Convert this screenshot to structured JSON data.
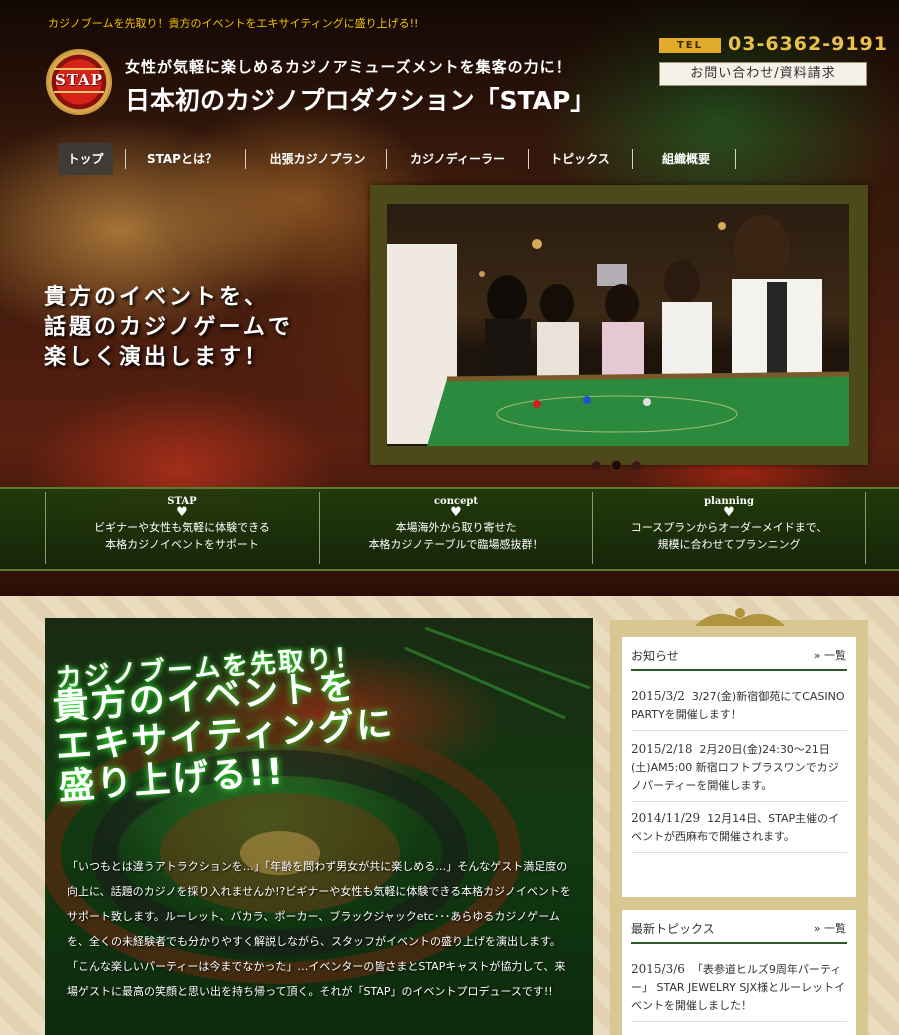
{
  "header": {
    "tagline": "カジノブームを先取り！貴方のイベントをエキサイティングに盛り上げる!!",
    "logo_text": "STAP",
    "subtitle": "女性が気軽に楽しめるカジノアミューズメントを集客の力に！",
    "title": "日本初のカジノプロダクション「STAP」",
    "tel_label": "TEL",
    "tel_number": "03-6362-9191",
    "contact_button": "お問い合わせ/資料請求"
  },
  "nav": {
    "items": [
      "トップ",
      "STAPとは？",
      "出張カジノプラン",
      "カジノディーラー",
      "トピックス",
      "組織概要"
    ]
  },
  "hero": {
    "copy_line1": "貴方のイベントを、",
    "copy_line2": "話題のカジノゲームで",
    "copy_line3": "楽しく演出します！"
  },
  "slider": {
    "active_index": 1
  },
  "features": [
    {
      "head": "STAP",
      "line1": "ビギナーや女性も気軽に体験できる",
      "line2": "本格カジノイベントをサポート"
    },
    {
      "head": "concept",
      "line1": "本場海外から取り寄せた",
      "line2": "本格カジノテーブルで臨場感抜群！"
    },
    {
      "head": "planning",
      "line1": "コースプランからオーダーメイドまで、",
      "line2": "規模に合わせてプランニング"
    }
  ],
  "promo": {
    "heading1": "カジノブームを先取り！",
    "heading2_line1": "貴方のイベントを",
    "heading2_line2": "エキサイティングに",
    "heading2_line3": "盛り上げる!!",
    "body": "「いつもとは違うアトラクションを…」「年齢を問わず男女が共に楽しめる…」そんなゲスト満足度の向上に、話題のカジノを採り入れませんか!?ビギナーや女性も気軽に体験できる本格カジノイベントをサポート致します。ルーレット、バカラ、ポーカー、ブラックジャックetc･･･あらゆるカジノゲームを、全くの未経験者でも分かりやすく解説しながら、スタッフがイベントの盛り上げを演出します。「こんな楽しいパーティーは今までなかった」…イベンターの皆さまとSTAPキャストが協力して、来場ゲストに最高の笑顔と思い出を持ち帰って頂く。それが「STAP」のイベントプロデュースです!!"
  },
  "news": {
    "title": "お知らせ",
    "more": "» 一覧",
    "items": [
      {
        "date": "2015/3/2",
        "text": "3/27(金)新宿御苑にてCASINO PARTYを開催します！"
      },
      {
        "date": "2015/2/18",
        "text": "2月20日(金)24:30～21日(土)AM5:00 新宿ロフトプラスワンでカジノパーティーを開催します。"
      },
      {
        "date": "2014/11/29",
        "text": "12月14日、STAP主催のイベントが西麻布で開催されます。"
      }
    ]
  },
  "topics": {
    "title": "最新トピックス",
    "more": "» 一覧",
    "items": [
      {
        "date": "2015/3/6",
        "text": "「表参道ヒルズ9周年パーティー」 STAR JEWELRY SJX様とルーレットイベントを開催しました！"
      }
    ]
  },
  "colors": {
    "accent_gold": "#e8c24a",
    "tagline_yellow": "#f2c400",
    "rule_green": "#2e5a2a"
  }
}
